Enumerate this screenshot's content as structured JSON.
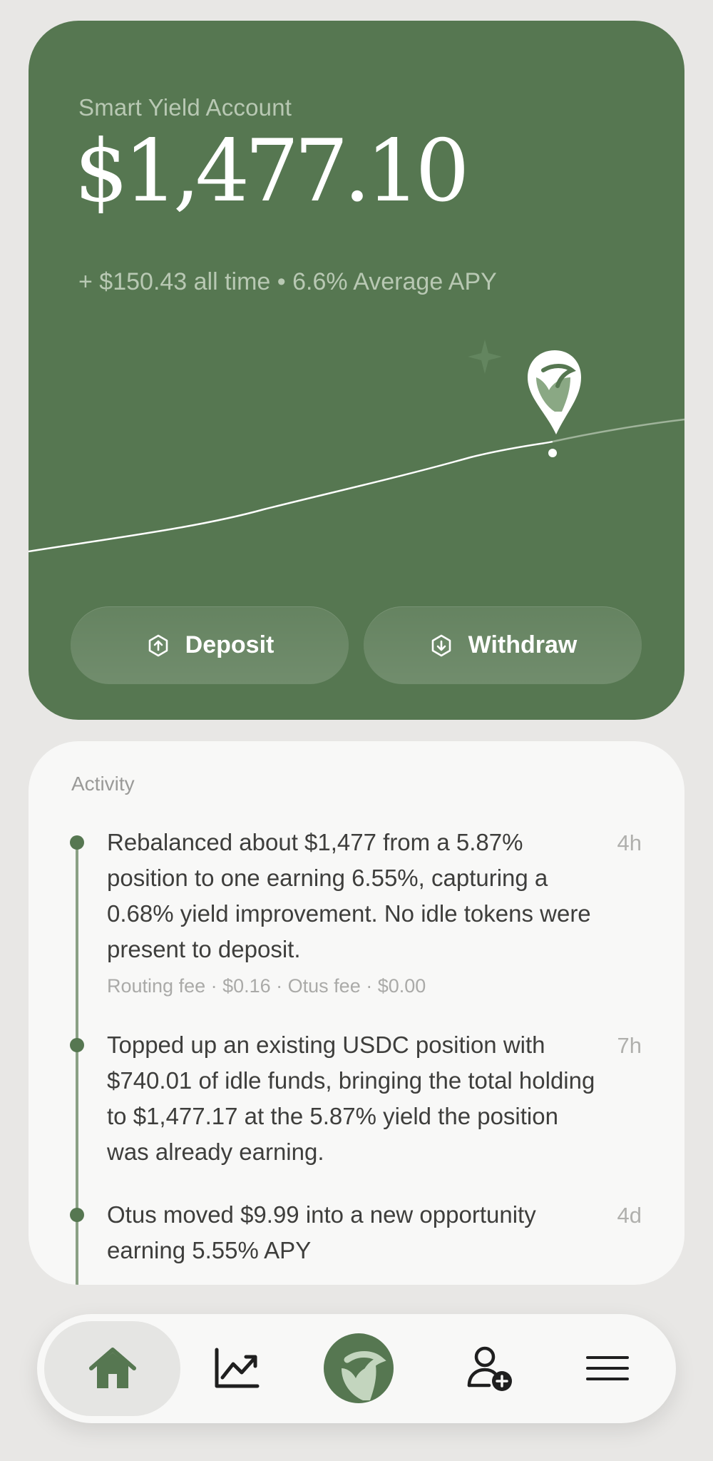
{
  "account": {
    "name": "Smart Yield Account",
    "balance": "$1,477.10",
    "summary": "+ $150.43 all time • 6.6% Average APY"
  },
  "actions": {
    "deposit_label": "Deposit",
    "withdraw_label": "Withdraw"
  },
  "activity": {
    "title": "Activity",
    "items": [
      {
        "text": "Rebalanced about $1,477 from a 5.87% position to one earning 6.55%, capturing a 0.68% yield improvement. No idle tokens were present to deposit.",
        "fee": "Routing fee · $0.16 · Otus fee · $0.00",
        "time": "4h"
      },
      {
        "text": "Topped up an existing USDC position with $740.01 of idle funds, bringing the total holding to $1,477.17 at the 5.87% yield the position was already earning.",
        "time": "7h"
      },
      {
        "text": "Otus moved $9.99 into a new opportunity earning 5.55% APY",
        "time": "4d"
      }
    ]
  },
  "nav": {
    "items": [
      "home-icon",
      "chart-trend-icon",
      "otus-logo-icon",
      "add-user-icon",
      "menu-icon"
    ],
    "active": "home-icon"
  },
  "colors": {
    "accent": "#567751",
    "background": "#e8e7e5",
    "card": "#f8f8f7"
  }
}
